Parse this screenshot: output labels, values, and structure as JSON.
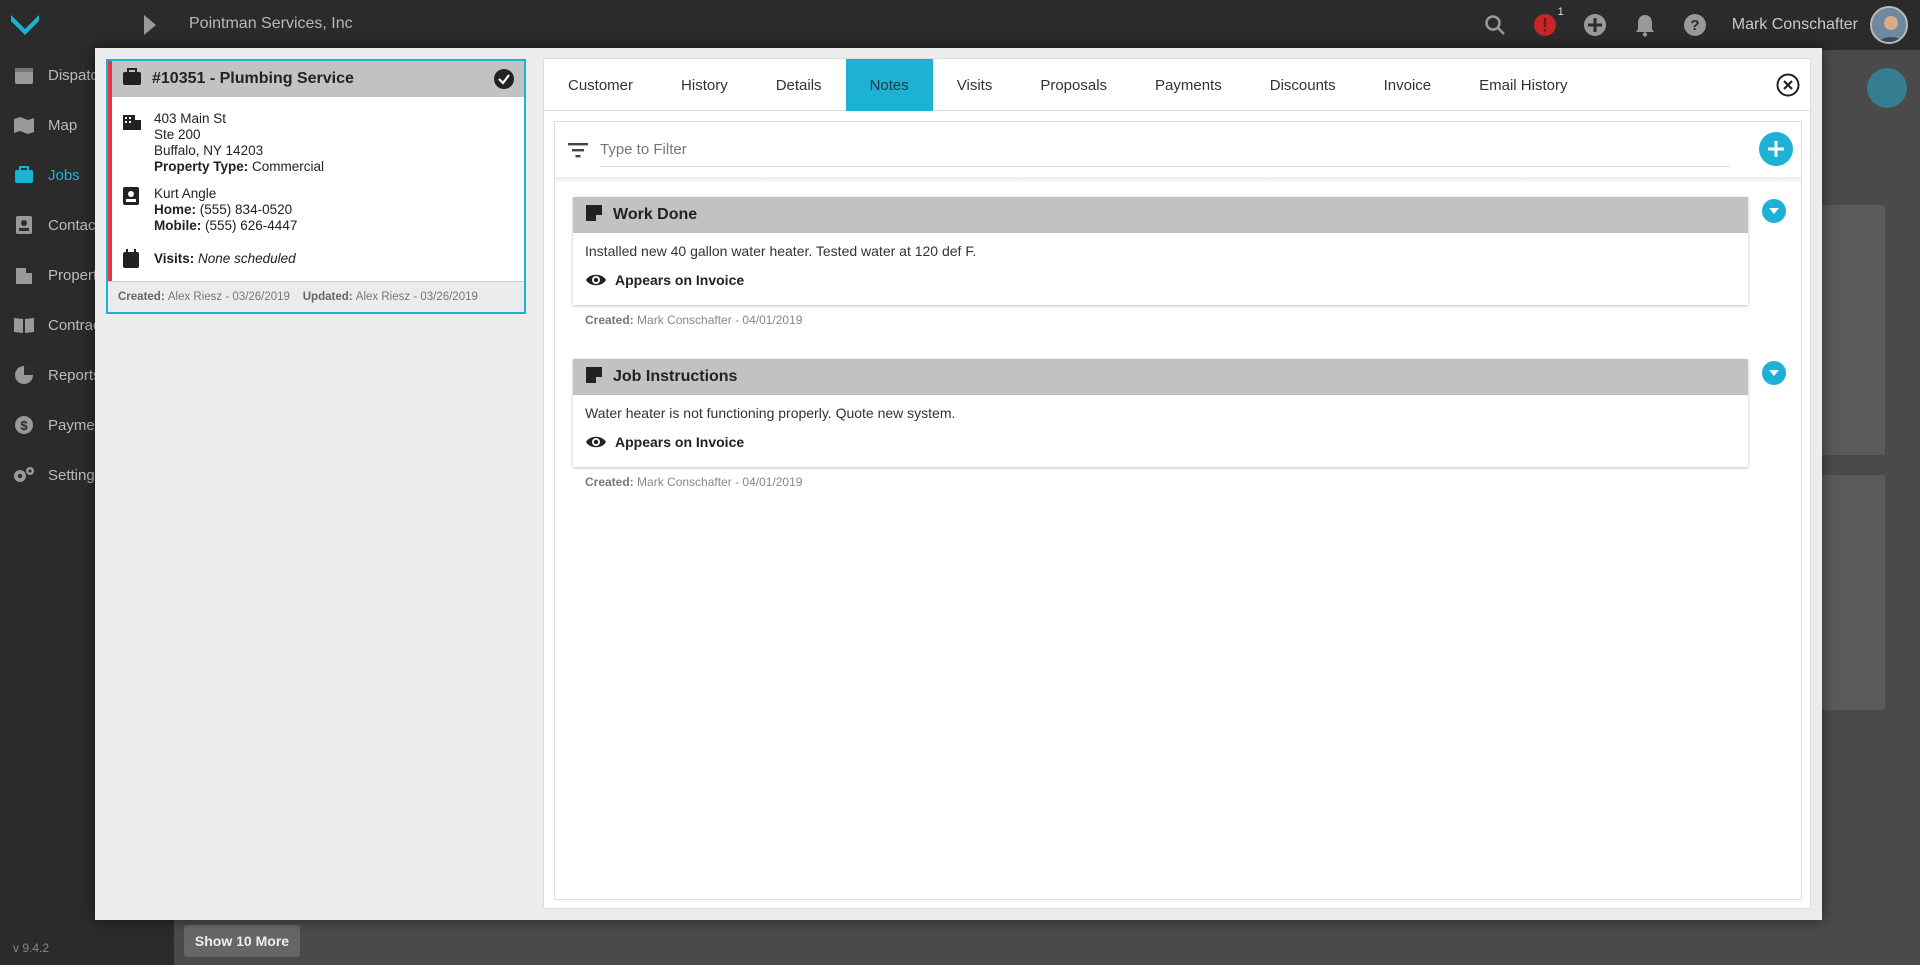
{
  "app": {
    "company": "Pointman Services, Inc",
    "user_name": "Mark Conschafter",
    "alert_count": "1",
    "version": "v 9.4.2",
    "accent_color": "#1eb1d6"
  },
  "sidebar": {
    "items": [
      {
        "label": "Dispatch",
        "icon": "calendar-icon"
      },
      {
        "label": "Map",
        "icon": "map-icon"
      },
      {
        "label": "Jobs",
        "icon": "briefcase-icon"
      },
      {
        "label": "Contacts",
        "icon": "contact-icon"
      },
      {
        "label": "Properties",
        "icon": "building-icon"
      },
      {
        "label": "Contracts",
        "icon": "book-icon"
      },
      {
        "label": "Reports",
        "icon": "pie-chart-icon"
      },
      {
        "label": "Payments",
        "icon": "dollar-icon"
      },
      {
        "label": "Settings",
        "icon": "gears-icon"
      }
    ]
  },
  "background": {
    "show_more_label": "Show 10 More"
  },
  "job": {
    "title": "#10351 - Plumbing Service",
    "address_line1": "403 Main St",
    "address_line2": "Ste 200",
    "address_line3": "Buffalo, NY 14203",
    "property_type_label": "Property Type:",
    "property_type_value": "Commercial",
    "contact_name": "Kurt Angle",
    "home_label": "Home:",
    "home_phone": "(555) 834-0520",
    "mobile_label": "Mobile:",
    "mobile_phone": "(555) 626-4447",
    "visits_label": "Visits:",
    "visits_value": "None scheduled",
    "created_label": "Created:",
    "created_value": "Alex Riesz - 03/26/2019",
    "updated_label": "Updated:",
    "updated_value": "Alex Riesz - 03/26/2019"
  },
  "tabs": [
    {
      "label": "Customer"
    },
    {
      "label": "History"
    },
    {
      "label": "Details"
    },
    {
      "label": "Notes",
      "active": true
    },
    {
      "label": "Visits"
    },
    {
      "label": "Proposals"
    },
    {
      "label": "Payments"
    },
    {
      "label": "Discounts"
    },
    {
      "label": "Invoice"
    },
    {
      "label": "Email History"
    }
  ],
  "filter": {
    "placeholder": "Type to Filter"
  },
  "notes": [
    {
      "title": "Work Done",
      "body": "Installed new 40 gallon water heater. Tested water at 120 def F.",
      "visibility": "Appears on Invoice",
      "created_label": "Created:",
      "created_value": "Mark Conschafter - 04/01/2019"
    },
    {
      "title": "Job Instructions",
      "body": "Water heater is not functioning properly. Quote new system.",
      "visibility": "Appears on Invoice",
      "created_label": "Created:",
      "created_value": "Mark Conschafter - 04/01/2019"
    }
  ]
}
